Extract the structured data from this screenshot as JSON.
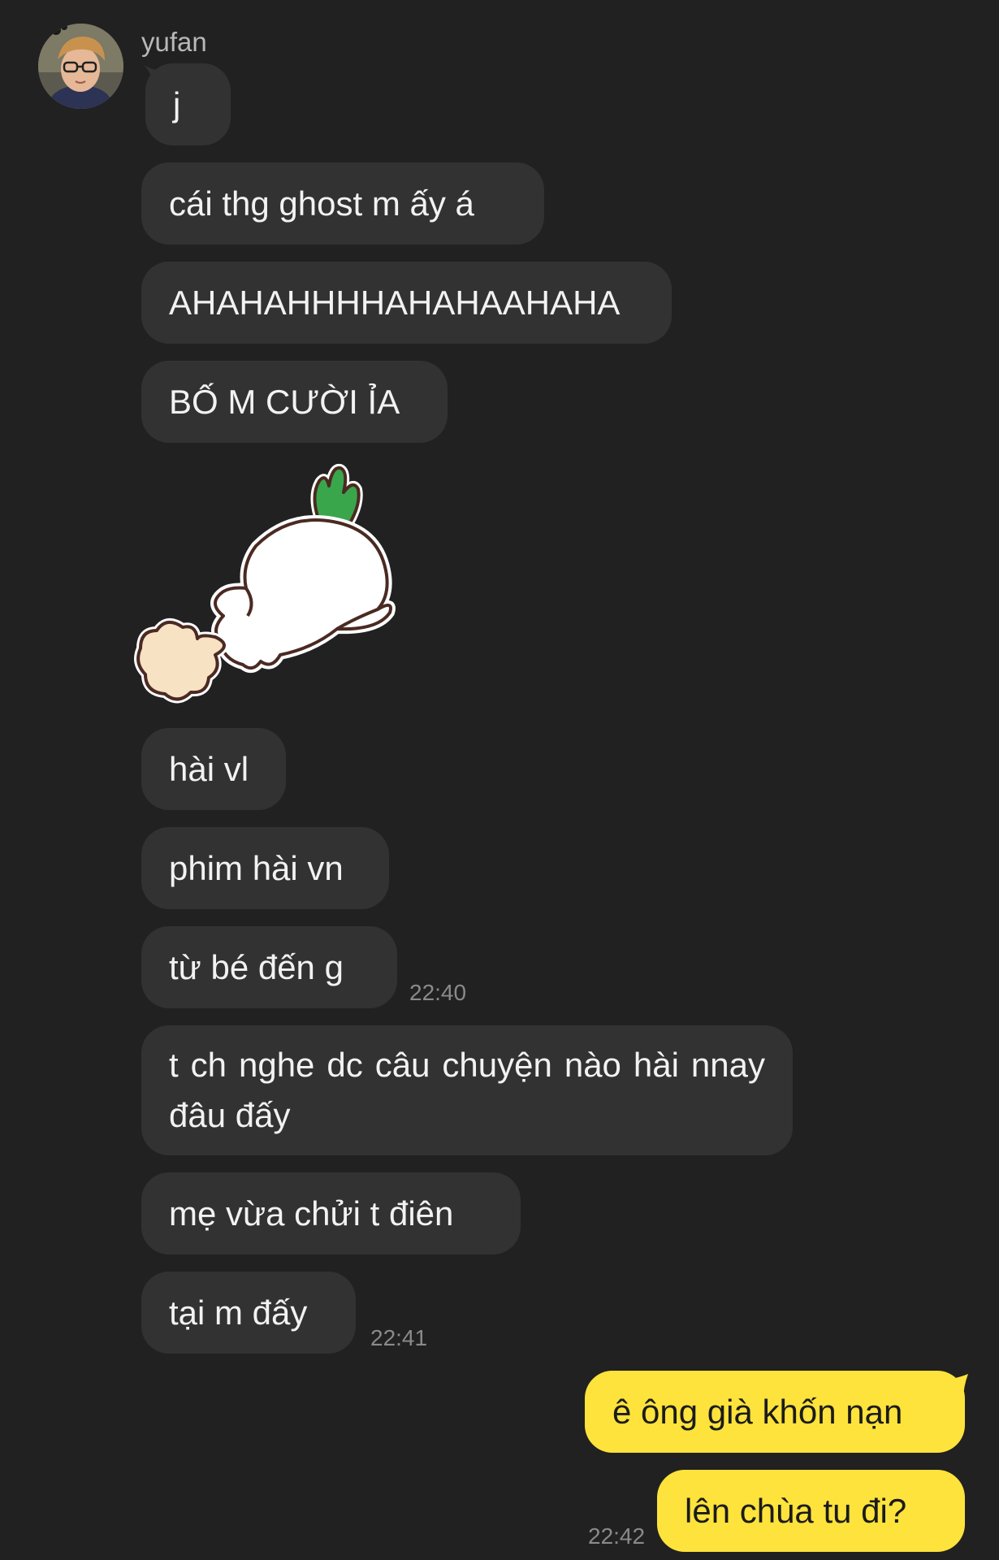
{
  "sender": {
    "name": "yufan",
    "avatar_icon": "avatar-photo-icon"
  },
  "incoming_messages": [
    {
      "text": "j"
    },
    {
      "text": "cái thg ghost m ấy á"
    },
    {
      "text": "AHAHAHHHHAHAHAAHAHA"
    },
    {
      "text": "BỐ M CƯỜI ỈA"
    },
    {
      "type": "sticker",
      "icon": "radish-bunny-running-sticker"
    },
    {
      "text": "hài vl"
    },
    {
      "text": "phim hài vn"
    },
    {
      "text": "từ bé đến g",
      "time": "22:40"
    },
    {
      "text": "t ch nghe dc câu chuyện nào hài nnay đâu đấy"
    },
    {
      "text": "mẹ vừa chửi t điên"
    },
    {
      "text": "tại m đấy",
      "time": "22:41"
    }
  ],
  "outgoing_messages": [
    {
      "text": "ê ông già khốn nạn"
    },
    {
      "text": "lên chùa tu đi?",
      "time": "22:42"
    }
  ],
  "colors": {
    "background": "#212121",
    "incoming_bubble": "#323232",
    "outgoing_bubble": "#fde33b",
    "incoming_text": "#f2f2f2",
    "outgoing_text": "#1b1b1b",
    "timestamp": "#8a8a8a"
  }
}
